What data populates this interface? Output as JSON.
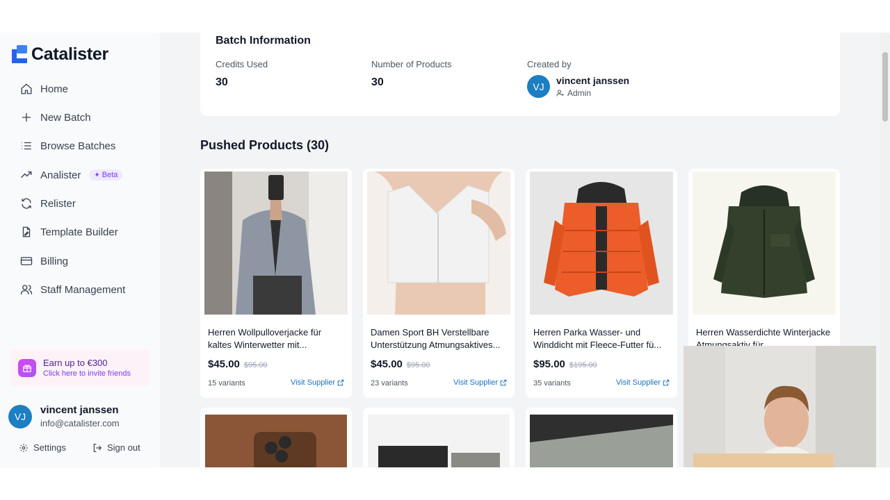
{
  "app": {
    "name": "Catalister"
  },
  "sidebar": {
    "items": [
      {
        "label": "Home",
        "icon": "home-icon"
      },
      {
        "label": "New Batch",
        "icon": "plus-icon"
      },
      {
        "label": "Browse Batches",
        "icon": "list-icon"
      },
      {
        "label": "Analister",
        "icon": "trending-icon",
        "badge": "Beta"
      },
      {
        "label": "Relister",
        "icon": "refresh-icon"
      },
      {
        "label": "Template Builder",
        "icon": "file-edit-icon"
      },
      {
        "label": "Billing",
        "icon": "credit-card-icon"
      },
      {
        "label": "Staff Management",
        "icon": "users-icon"
      }
    ],
    "invite": {
      "title": "Earn up to €300",
      "subtitle": "Click here to invite friends"
    },
    "user": {
      "initials": "VJ",
      "name": "vincent janssen",
      "email": "info@catalister.com"
    },
    "settings_label": "Settings",
    "signout_label": "Sign out"
  },
  "batch": {
    "title": "Batch Information",
    "credits_label": "Credits Used",
    "credits_value": "30",
    "products_label": "Number of Products",
    "products_value": "30",
    "created_label": "Created by",
    "creator_initials": "VJ",
    "creator_name": "vincent janssen",
    "creator_role": "Admin"
  },
  "products": {
    "title": "Pushed Products (30)",
    "visit_label": "Visit Supplier",
    "items": [
      {
        "title": "Herren Wollpulloverjacke für kaltes Winterwetter mit...",
        "price": "$45.00",
        "old_price": "$95.00",
        "variants": "15 variants"
      },
      {
        "title": "Damen Sport BH Verstellbare Unterstützung Atmungsaktives...",
        "price": "$45.00",
        "old_price": "$95.00",
        "variants": "23 variants"
      },
      {
        "title": "Herren Parka Wasser- und Winddicht mit Fleece-Futter fü...",
        "price": "$95.00",
        "old_price": "$195.00",
        "variants": "35 variants"
      },
      {
        "title": "Herren Wasserdichte Winterjacke Atmungsaktiv für...",
        "price": "",
        "old_price": "",
        "variants": ""
      }
    ]
  },
  "colors": {
    "accent": "#1d7ec2",
    "brand": "#2563eb",
    "beta": "#7c3aed"
  }
}
